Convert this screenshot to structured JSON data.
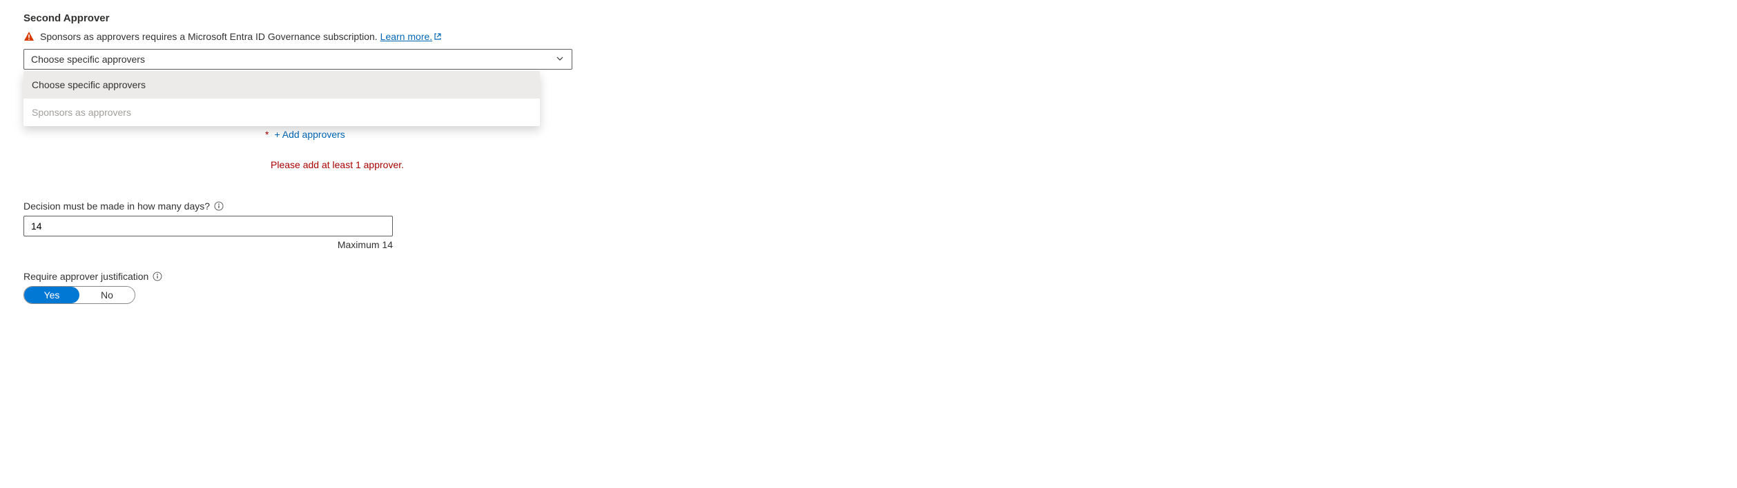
{
  "section_title": "Second Approver",
  "warning": {
    "text": "Sponsors as approvers requires a Microsoft Entra ID Governance subscription. ",
    "link_text": "Learn more."
  },
  "dropdown": {
    "selected": "Choose specific approvers",
    "options": {
      "specific": "Choose specific approvers",
      "sponsors": "Sponsors as approvers"
    }
  },
  "add_approvers": {
    "star": "*",
    "label": "+ Add approvers"
  },
  "error": "Please add at least 1 approver.",
  "decision_days": {
    "label": "Decision must be made in how many days?",
    "value": "14",
    "helper": "Maximum 14"
  },
  "justification": {
    "label": "Require approver justification",
    "yes": "Yes",
    "no": "No"
  }
}
